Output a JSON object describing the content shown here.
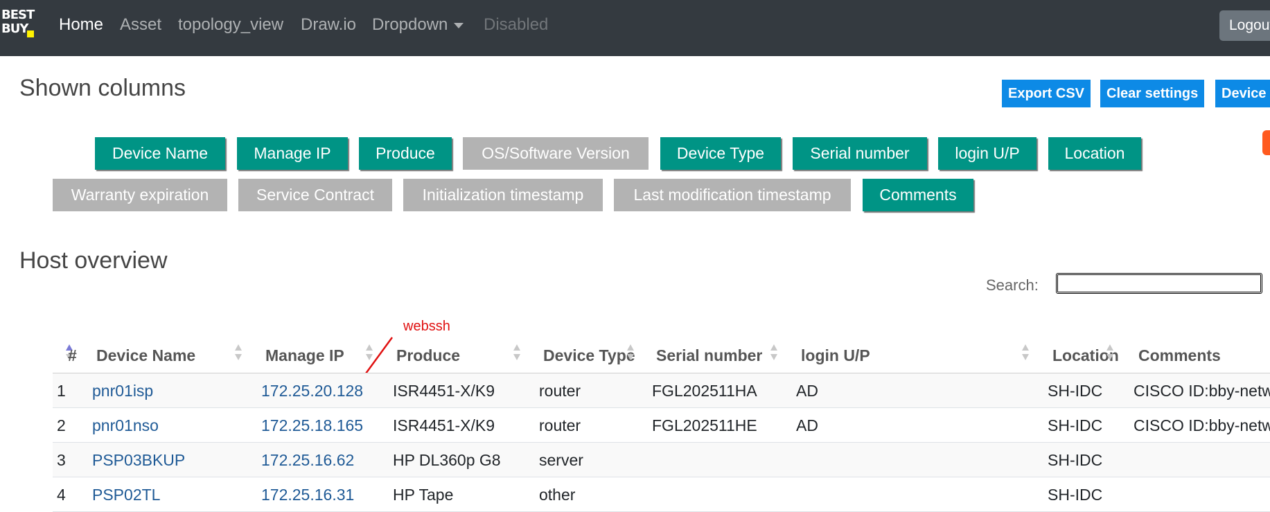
{
  "navbar": {
    "logo_text": "BEST BUY",
    "links": [
      "Home",
      "Asset",
      "topology_view",
      "Draw.io",
      "Dropdown",
      "Disabled"
    ],
    "logout_label": "Logout",
    "bg_color": "#343a40"
  },
  "shown_columns": {
    "heading": "Shown columns",
    "buttons": [
      {
        "label": "Device Name",
        "active": true
      },
      {
        "label": "Manage IP",
        "active": true
      },
      {
        "label": "Produce",
        "active": true
      },
      {
        "label": "OS/Software Version",
        "active": false
      },
      {
        "label": "Device Type",
        "active": true
      },
      {
        "label": "Serial number",
        "active": true
      },
      {
        "label": "login U/P",
        "active": true
      },
      {
        "label": "Location",
        "active": true
      },
      {
        "label": "Warranty expiration",
        "active": false
      },
      {
        "label": "Service Contract",
        "active": false
      },
      {
        "label": "Initialization timestamp",
        "active": false
      },
      {
        "label": "Last modification timestamp",
        "active": false
      },
      {
        "label": "Comments",
        "active": true
      }
    ]
  },
  "actions": {
    "export_csv": "Export CSV",
    "clear_settings": "Clear settings",
    "device_add": "Device a"
  },
  "host_overview": {
    "heading": "Host overview",
    "search_label": "Search:",
    "search_value": "",
    "annotation": "webssh",
    "columns": [
      "#",
      "Device Name",
      "Manage IP",
      "Produce",
      "Device Type",
      "Serial number",
      "login U/P",
      "Location",
      "Comments"
    ],
    "rows": [
      {
        "num": "1",
        "device_name": "pnr01isp",
        "manage_ip": "172.25.20.128",
        "produce": "ISR4451-X/K9",
        "device_type": "router",
        "serial": "FGL202511HA",
        "login": "AD",
        "location": "SH-IDC",
        "comments": "CISCO ID:bby-netw"
      },
      {
        "num": "2",
        "device_name": "pnr01nso",
        "manage_ip": "172.25.18.165",
        "produce": "ISR4451-X/K9",
        "device_type": "router",
        "serial": "FGL202511HE",
        "login": "AD",
        "location": "SH-IDC",
        "comments": "CISCO ID:bby-netw"
      },
      {
        "num": "3",
        "device_name": "PSP03BKUP",
        "manage_ip": "172.25.16.62",
        "produce": "HP DL360p G8",
        "device_type": "server",
        "serial": "",
        "login": "",
        "location": "SH-IDC",
        "comments": ""
      },
      {
        "num": "4",
        "device_name": "PSP02TL",
        "manage_ip": "172.25.16.31",
        "produce": "HP Tape",
        "device_type": "other",
        "serial": "",
        "login": "",
        "location": "SH-IDC",
        "comments": ""
      }
    ]
  },
  "colors": {
    "active_column": "#009485",
    "inactive_column": "#b3b3b3",
    "action_button": "#0d8ae6",
    "link": "#1f5a96",
    "annotation": "#e01010"
  }
}
